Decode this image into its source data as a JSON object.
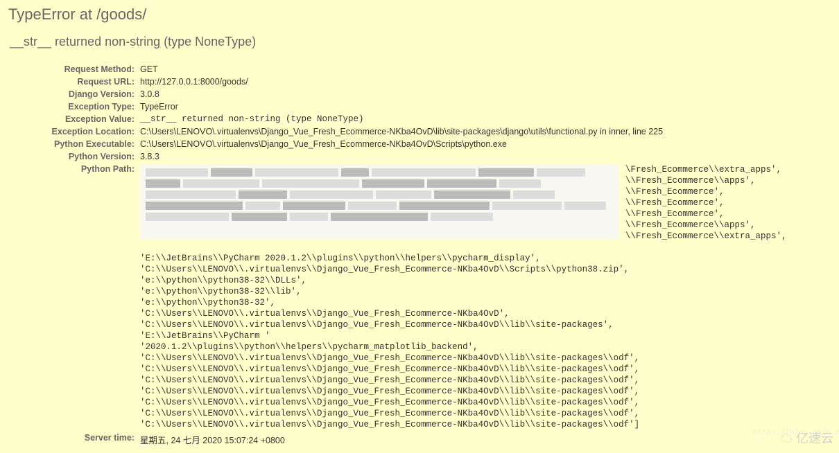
{
  "error": {
    "title": "TypeError at /goods/",
    "subtitle": "__str__ returned non-string (type NoneType)"
  },
  "info": {
    "request_method": {
      "label": "Request Method:",
      "value": "GET"
    },
    "request_url": {
      "label": "Request URL:",
      "value": "http://127.0.0.1:8000/goods/"
    },
    "django_version": {
      "label": "Django Version:",
      "value": "3.0.8"
    },
    "exception_type": {
      "label": "Exception Type:",
      "value": "TypeError"
    },
    "exception_value": {
      "label": "Exception Value:",
      "value": "__str__ returned non-string (type NoneType)"
    },
    "exception_location": {
      "label": "Exception Location:",
      "value": "C:\\Users\\LENOVO\\.virtualenvs\\Django_Vue_Fresh_Ecommerce-NKba4OvD\\lib\\site-packages\\django\\utils\\functional.py in inner, line 225"
    },
    "python_executable": {
      "label": "Python Executable:",
      "value": "C:\\Users\\LENOVO\\.virtualenvs\\Django_Vue_Fresh_Ecommerce-NKba4OvD\\Scripts\\python.exe"
    },
    "python_version": {
      "label": "Python Version:",
      "value": "3.8.3"
    },
    "python_path": {
      "label": "Python Path:"
    },
    "server_time": {
      "label": "Server time:",
      "value": "星期五, 24 七月 2020 15:07:24 +0800"
    }
  },
  "python_path_visible_tail_lines": [
    "\\Fresh_Ecommerce\\\\extra_apps',",
    "\\\\Fresh_Ecommerce\\\\apps',",
    "\\\\Fresh_Ecommerce',",
    "\\\\Fresh_Ecommerce',",
    "\\\\Fresh_Ecommerce',",
    "\\\\Fresh_Ecommerce\\\\apps',",
    "\\\\Fresh_Ecommerce\\\\extra_apps',"
  ],
  "python_path_lines": [
    "'E:\\\\JetBrains\\\\PyCharm 2020.1.2\\\\plugins\\\\python\\\\helpers\\\\pycharm_display',",
    "'C:\\\\Users\\\\LENOVO\\\\.virtualenvs\\\\Django_Vue_Fresh_Ecommerce-NKba4OvD\\\\Scripts\\\\python38.zip',",
    "'e:\\\\python\\\\python38-32\\\\DLLs',",
    "'e:\\\\python\\\\python38-32\\\\lib',",
    "'e:\\\\python\\\\python38-32',",
    "'C:\\\\Users\\\\LENOVO\\\\.virtualenvs\\\\Django_Vue_Fresh_Ecommerce-NKba4OvD',",
    "'C:\\\\Users\\\\LENOVO\\\\.virtualenvs\\\\Django_Vue_Fresh_Ecommerce-NKba4OvD\\\\lib\\\\site-packages',",
    "'E:\\\\JetBrains\\\\PyCharm '",
    "'2020.1.2\\\\plugins\\\\python\\\\helpers\\\\pycharm_matplotlib_backend',",
    "'C:\\\\Users\\\\LENOVO\\\\.virtualenvs\\\\Django_Vue_Fresh_Ecommerce-NKba4OvD\\\\lib\\\\site-packages\\\\odf',",
    "'C:\\\\Users\\\\LENOVO\\\\.virtualenvs\\\\Django_Vue_Fresh_Ecommerce-NKba4OvD\\\\lib\\\\site-packages\\\\odf',",
    "'C:\\\\Users\\\\LENOVO\\\\.virtualenvs\\\\Django_Vue_Fresh_Ecommerce-NKba4OvD\\\\lib\\\\site-packages\\\\odf',",
    "'C:\\\\Users\\\\LENOVO\\\\.virtualenvs\\\\Django_Vue_Fresh_Ecommerce-NKba4OvD\\\\lib\\\\site-packages\\\\odf',",
    "'C:\\\\Users\\\\LENOVO\\\\.virtualenvs\\\\Django_Vue_Fresh_Ecommerce-NKba4OvD\\\\lib\\\\site-packages\\\\odf',",
    "'C:\\\\Users\\\\LENOVO\\\\.virtualenvs\\\\Django_Vue_Fresh_Ecommerce-NKba4OvD\\\\lib\\\\site-packages\\\\odf',",
    "'C:\\\\Users\\\\LENOVO\\\\.virtualenvs\\\\Django_Vue_Fresh_Ecommerce-NKba4OvD\\\\lib\\\\site-packages\\\\odf']"
  ],
  "watermark": "https://blog.csdn.ne",
  "logo": "亿速云"
}
